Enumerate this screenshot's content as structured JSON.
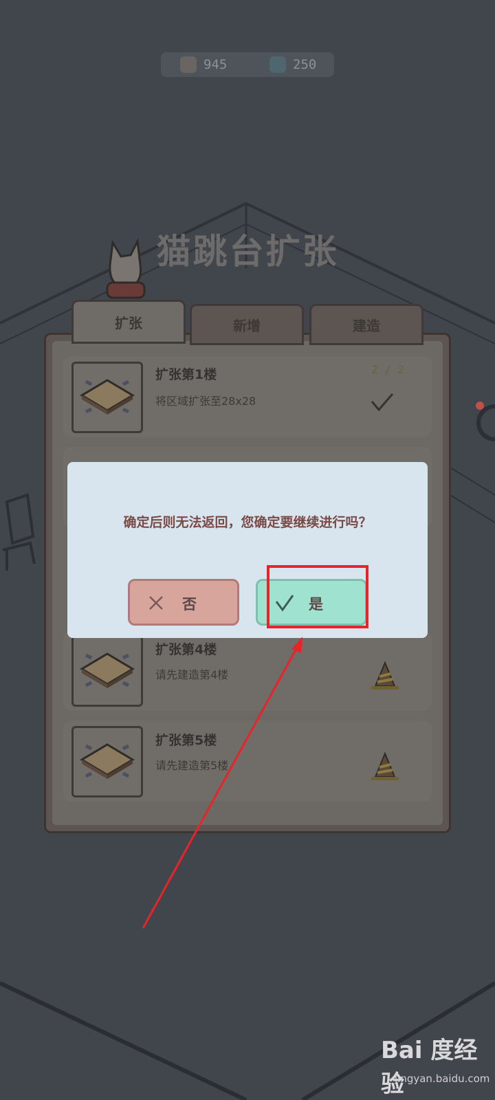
{
  "currency": {
    "coins": "945",
    "gems": "250"
  },
  "page_title": "猫跳台扩张",
  "tabs": [
    "扩张",
    "新增",
    "建造"
  ],
  "cards": [
    {
      "title": "扩张第1楼",
      "desc": "将区域扩张至28x28",
      "progress": "2 / 2",
      "status": "completed"
    },
    {
      "title": "扩张第4楼",
      "desc": "请先建造第4楼",
      "status": "locked"
    },
    {
      "title": "扩张第5楼",
      "desc": "请先建造第5楼",
      "status": "locked"
    }
  ],
  "dialog": {
    "message": "确定后则无法返回，您确定要继续进行吗？",
    "no_label": "否",
    "yes_label": "是"
  },
  "watermark": {
    "logo": "Bai 度经验",
    "url": "jingyan.baidu.com"
  },
  "colors": {
    "highlight": "#e8232a",
    "yes_button": "#9ee2cf",
    "no_button": "#d8a59c"
  }
}
